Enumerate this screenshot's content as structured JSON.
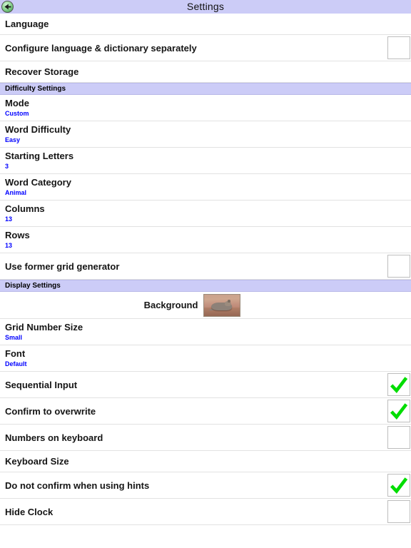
{
  "titlebar": {
    "title": "Settings",
    "back_icon": "back-arrow-icon",
    "background_color": "#ccccf7"
  },
  "colors": {
    "accent_header": "#ccccf7",
    "value_text": "#0000ff",
    "checkmark": "#00dd00",
    "divider": "#e2e2e2",
    "label_text": "#151515"
  },
  "sections": [
    {
      "header": null,
      "rows": [
        {
          "label": "Language",
          "type": "plain"
        },
        {
          "label": "Configure language & dictionary separately",
          "type": "checkbox",
          "checked": false
        },
        {
          "label": "Recover Storage",
          "type": "plain"
        }
      ]
    },
    {
      "header": "Difficulty Settings",
      "rows": [
        {
          "label": "Mode",
          "type": "value",
          "value": "Custom"
        },
        {
          "label": "Word Difficulty",
          "type": "value",
          "value": "Easy"
        },
        {
          "label": "Starting Letters",
          "type": "value",
          "value": "3"
        },
        {
          "label": "Word Category",
          "type": "value",
          "value": "Animal"
        },
        {
          "label": "Columns",
          "type": "value",
          "value": "13"
        },
        {
          "label": "Rows",
          "type": "value",
          "value": "13"
        },
        {
          "label": "Use former grid generator",
          "type": "checkbox",
          "checked": false
        }
      ]
    },
    {
      "header": "Display Settings",
      "rows": [
        {
          "label": "Background",
          "type": "image",
          "image_name": "background-thumbnail-animal-photo"
        },
        {
          "label": "Grid Number Size",
          "type": "value",
          "value": "Small"
        },
        {
          "label": "Font",
          "type": "value",
          "value": "Default"
        },
        {
          "label": "Sequential Input",
          "type": "checkbox",
          "checked": true
        },
        {
          "label": "Confirm to overwrite",
          "type": "checkbox",
          "checked": true
        },
        {
          "label": "Numbers on keyboard",
          "type": "checkbox",
          "checked": false
        },
        {
          "label": "Keyboard Size",
          "type": "plain"
        },
        {
          "label": "Do not confirm when using hints",
          "type": "checkbox",
          "checked": true
        },
        {
          "label": "Hide Clock",
          "type": "checkbox",
          "checked": false
        }
      ]
    }
  ]
}
